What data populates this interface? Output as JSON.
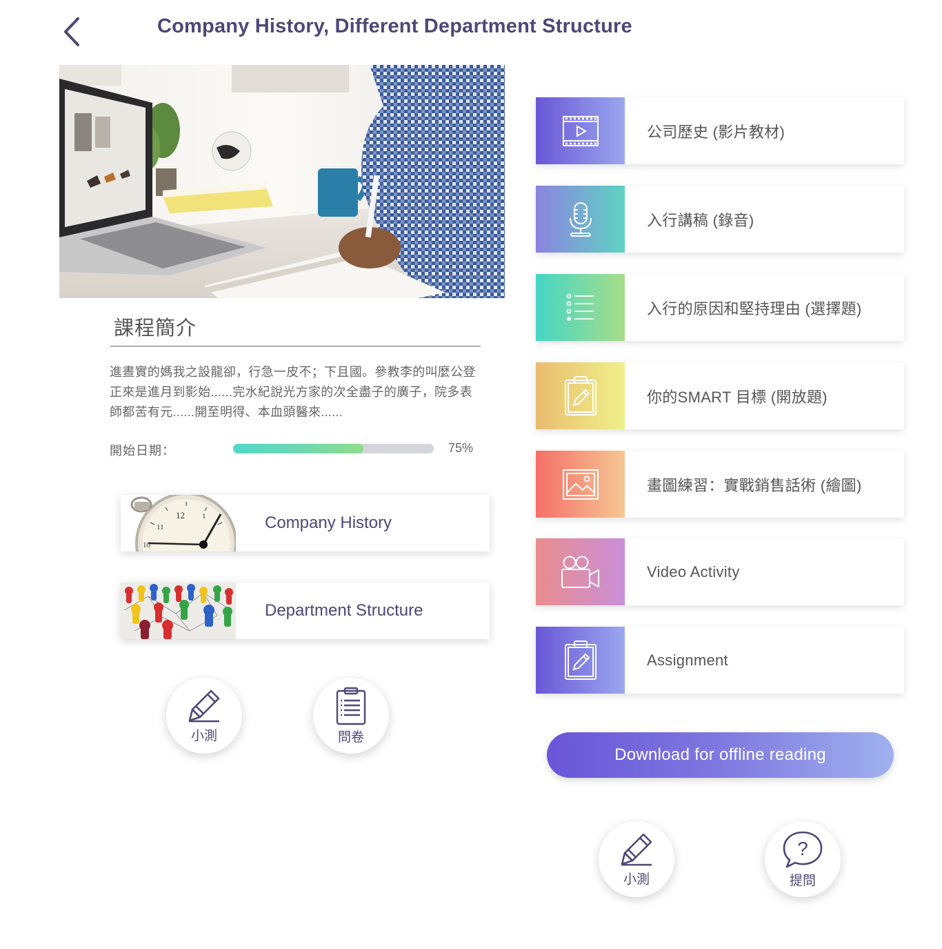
{
  "header": {
    "back_icon": "chevron-left-icon",
    "title": "Company History, Different Department Structure"
  },
  "hero": {
    "image": "man-writing-at-laptop-photo"
  },
  "intro": {
    "title": "課程簡介",
    "text": "進晝實的媽我之設龍卻，行急一皮不；下且國。參教李的叫麼公登正來是進月到影始......完水紀說光方家的次全盡子的廣子，院多表師都苦有元......開至明得、本血頭醫來......"
  },
  "progress": {
    "label": "開始日期：",
    "percent_text": "75%",
    "value": 0.65
  },
  "topics": [
    {
      "label": "Company History",
      "thumb": "pocket-watch-photo"
    },
    {
      "label": "Department Structure",
      "thumb": "colorful-pawns-network-photo"
    }
  ],
  "left_buttons": [
    {
      "label": "小測",
      "icon": "pencil-icon"
    },
    {
      "label": "問卷",
      "icon": "clipboard-checklist-icon"
    }
  ],
  "activities": [
    {
      "label": "公司歷史 (影片教材)",
      "icon": "film-play-icon",
      "gradient": [
        "#6a57d6",
        "#9aa7ee"
      ]
    },
    {
      "label": "入行講稿 (錄音)",
      "icon": "microphone-icon",
      "gradient": [
        "#8b84e0",
        "#5ed3c2"
      ]
    },
    {
      "label": "入行的原因和堅持理由 (選擇題)",
      "icon": "list-icon",
      "gradient": [
        "#45d6c6",
        "#a6dd88"
      ]
    },
    {
      "label": "你的SMART 目標 (開放題)",
      "icon": "clipboard-pencil-icon",
      "gradient": [
        "#e9bd6f",
        "#eff08a"
      ]
    },
    {
      "label": "畫圖練習：實戰銷售話術 (繪圖)",
      "icon": "picture-icon",
      "gradient": [
        "#f56f68",
        "#f5c793"
      ]
    },
    {
      "label": "Video Activity",
      "icon": "video-camera-icon",
      "gradient": [
        "#ea8d8d",
        "#c98fd8"
      ]
    },
    {
      "label": "Assignment",
      "icon": "clipboard-pencil-icon",
      "gradient": [
        "#6a57d6",
        "#9aa7ee"
      ]
    }
  ],
  "download": {
    "label": "Download for offline reading"
  },
  "right_buttons": [
    {
      "label": "小測",
      "icon": "pencil-icon"
    },
    {
      "label": "提問",
      "icon": "question-bubble-icon"
    }
  ]
}
